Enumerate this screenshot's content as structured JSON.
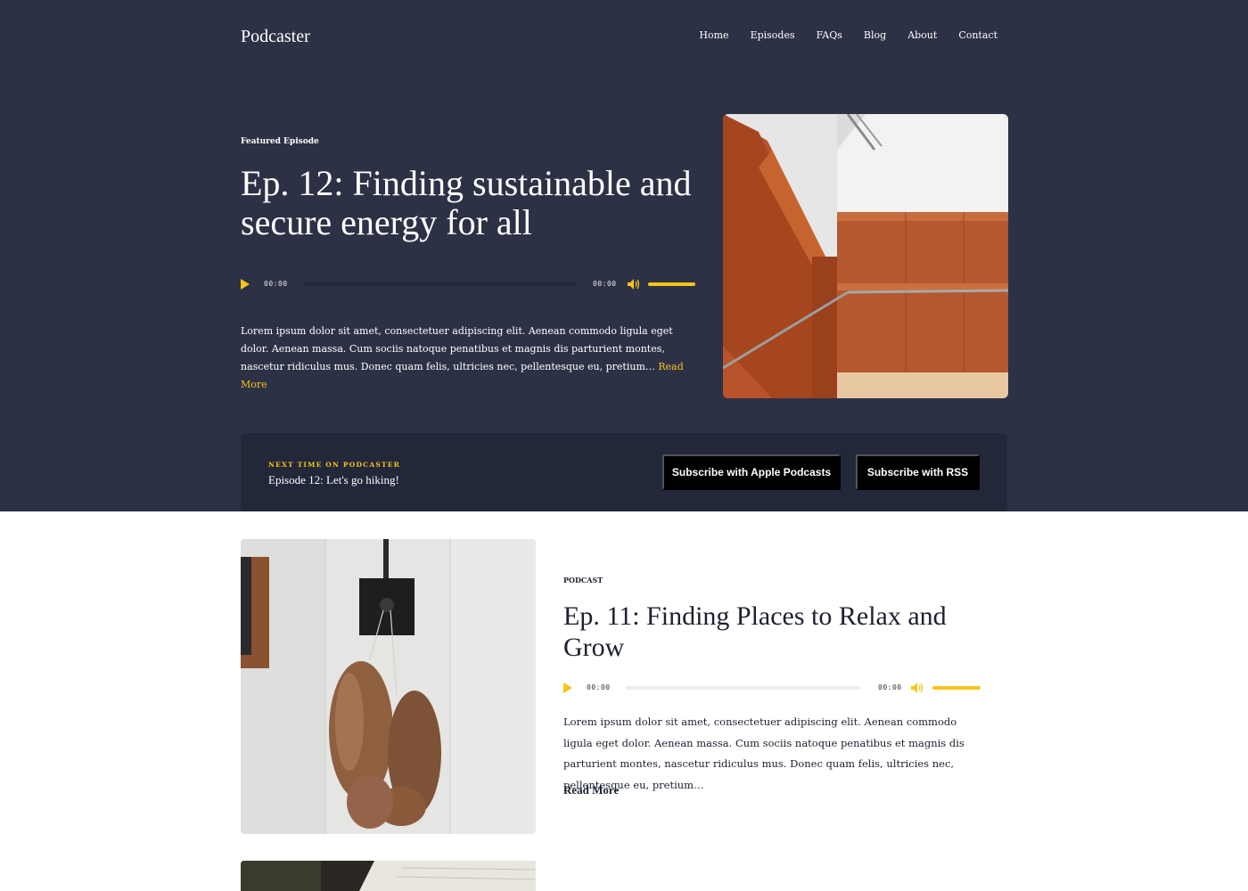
{
  "site": {
    "brand": "Podcaster"
  },
  "nav": [
    "Home",
    "Episodes",
    "FAQs",
    "Blog",
    "About",
    "Contact"
  ],
  "featured": {
    "kicker": "Featured Episode",
    "title": "Ep. 12: Finding sustainable and secure energy for all",
    "player": {
      "current": "00:00",
      "duration": "00:00",
      "progress": 0,
      "volume": 1.0
    },
    "excerpt": "Lorem ipsum dolor sit amet, consectetuer adipiscing elit. Aenean commodo ligula eget dolor. Aenean massa. Cum sociis natoque penatibus et magnis dis parturient montes, nascetur ridiculus mus. Donec quam felis, ultricies nec, pellentesque eu, pretium…",
    "read_more": "Read More"
  },
  "next": {
    "label": "NEXT TIME ON PODCASTER",
    "episode": "Episode 12: Let's go hiking!",
    "buttons": [
      "Subscribe with Apple Podcasts",
      "Subscribe with RSS"
    ]
  },
  "post": {
    "category": "PODCAST",
    "title": "Ep. 11: Finding Places to Relax and Grow",
    "player": {
      "current": "00:00",
      "duration": "00:00",
      "progress": 0,
      "volume": 1.0
    },
    "excerpt": "Lorem ipsum dolor sit amet, consectetuer adipiscing elit. Aenean commodo ligula eget dolor. Aenean massa. Cum sociis natoque penatibus et magnis dis parturient montes, nascetur ridiculus mus. Donec quam felis, ultricies nec, pellentesque eu, pretium…",
    "read_more": "Read More"
  },
  "colors": {
    "hero_bg": "#2d3146",
    "panel_bg": "#23273a",
    "accent": "#f5c518",
    "button_bg": "#000000"
  },
  "icons": {
    "play": "play-icon",
    "volume": "volume-icon"
  }
}
